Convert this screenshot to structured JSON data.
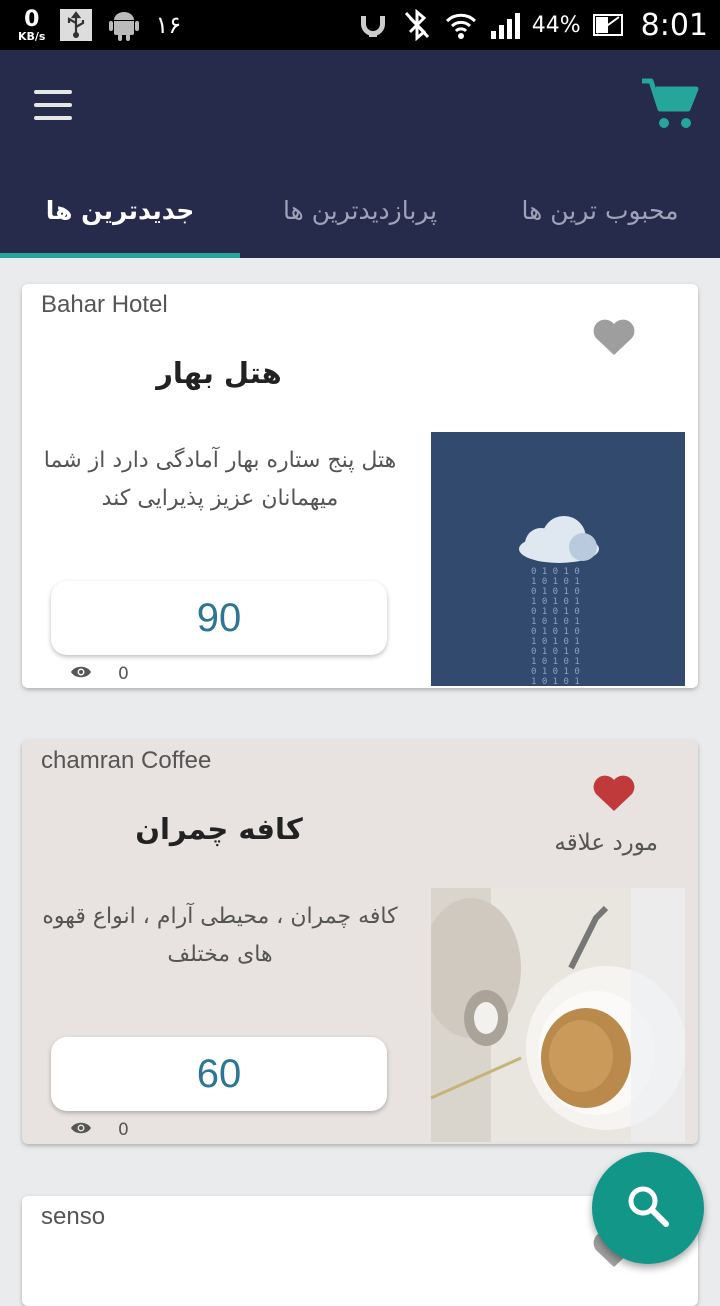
{
  "status_bar": {
    "net_speed": "0",
    "net_unit": "KB/s",
    "notif_count": "۱۶",
    "battery": "44%",
    "time": "8:01"
  },
  "tabs": [
    {
      "label": "جدیدترین ها",
      "active": true
    },
    {
      "label": "پربازدیدترین ها",
      "active": false
    },
    {
      "label": "محبوب ترین ها",
      "active": false
    }
  ],
  "cards": [
    {
      "name_en": "Bahar Hotel",
      "title": "هتل بهار",
      "description": "هتل پنج ستاره بهار آمادگی دارد از شما میهمانان عزیز پذیرایی کند",
      "price": "90",
      "views": "0",
      "favorite": false
    },
    {
      "name_en": "chamran Coffee",
      "title": "کافه چمران",
      "favorite_label": "مورد علاقه",
      "description": "کافه چمران ، محیطی آرام ، انواع قهوه های مختلف",
      "price": "60",
      "views": "0",
      "favorite": true
    },
    {
      "name_en": "senso"
    }
  ],
  "colors": {
    "appbar": "#262a4b",
    "accent": "#26a69a",
    "fab": "#129688",
    "price_text": "#2e7594",
    "heart_active": "#c0393b",
    "heart_inactive": "#9e9e9e"
  },
  "icons": [
    "menu-icon",
    "cart-icon",
    "heart-icon",
    "eye-icon",
    "search-icon"
  ]
}
